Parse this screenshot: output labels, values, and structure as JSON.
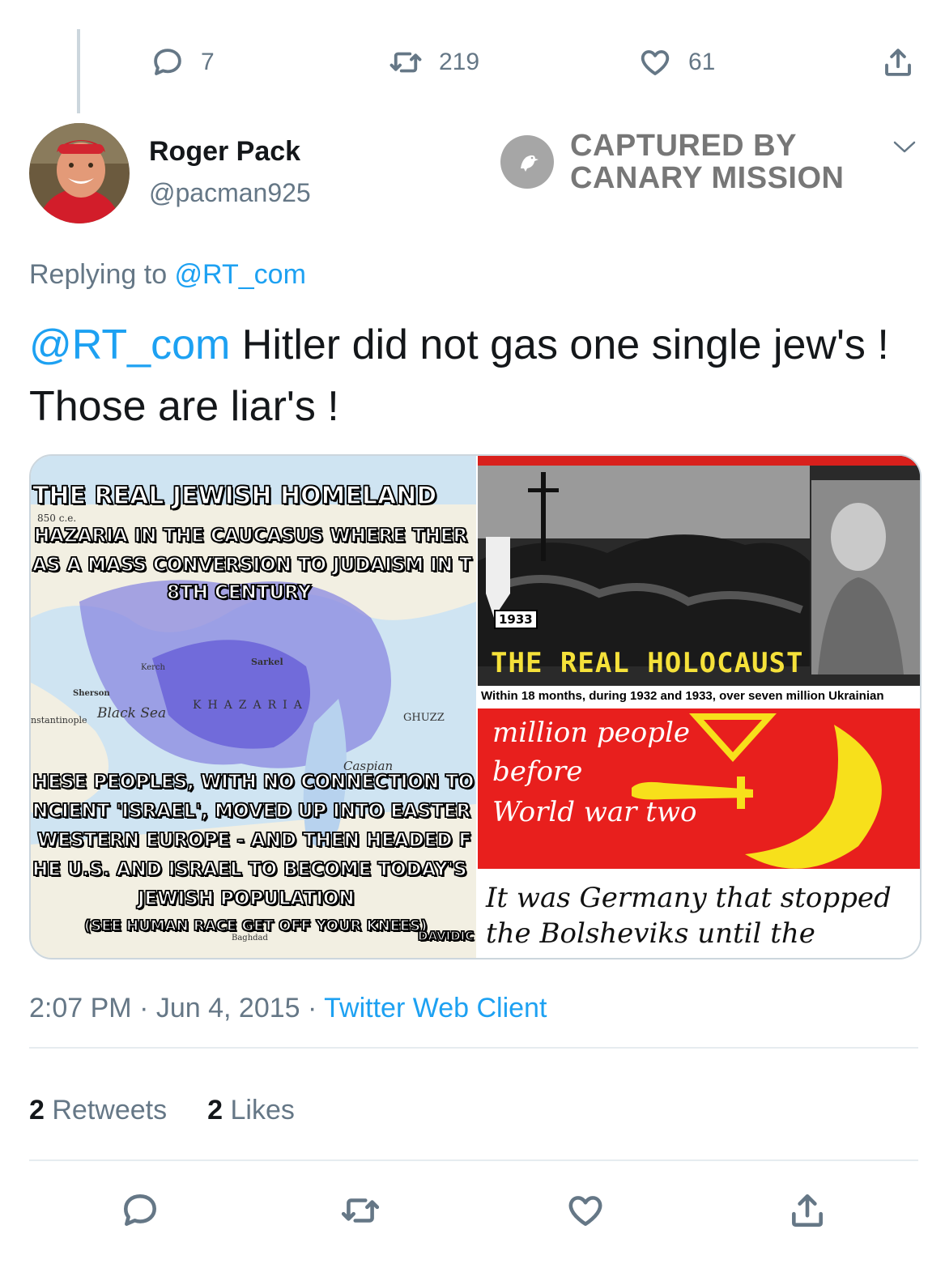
{
  "top_actions": {
    "replies": "7",
    "retweets": "219",
    "likes": "61"
  },
  "author": {
    "name": "Roger Pack",
    "handle": "@pacman925"
  },
  "watermark": {
    "line1": "CAPTURED BY",
    "line2": "CANARY MISSION"
  },
  "reply": {
    "prefix": "Replying to ",
    "mention": "@RT_com"
  },
  "tweet": {
    "mention": "@RT_com",
    "text": " Hitler did not gas one single jew's !  Those are liar's !"
  },
  "media": {
    "map": {
      "title": "THE REAL JEWISH HOMELAND",
      "line1": "HAZARIA IN THE CAUCASUS WHERE THER",
      "line2": "AS A MASS CONVERSION TO JUDAISM IN T",
      "line3": "8TH CENTURY",
      "line4": "HESE PEOPLES, WITH NO CONNECTION TO",
      "line5": "NCIENT 'ISRAEL', MOVED UP INTO EASTER",
      "line6": "WESTERN EUROPE - AND THEN HEADED F",
      "line7": "HE U.S. AND ISRAEL TO BECOME TODAY'S",
      "line8": "JEWISH POPULATION",
      "line9": "(SEE HUMAN RACE GET OFF YOUR KNEES)",
      "credit": "DAVIDIC",
      "labels": {
        "black_sea": "Black Sea",
        "khazaria": "KHAZARIA",
        "ghuzz": "GHUZZ",
        "sarkel": "Sarkel",
        "kerch": "Kerch",
        "sherson": "Sherson",
        "caspian": "Caspian",
        "baghdad": "Baghdad",
        "constantinople": "nstantinople",
        "c850": "850 c.e."
      }
    },
    "photo": {
      "year": "1933",
      "headline": "THE REAL HOLOCAUST",
      "caption": "Within 18 months, during 1932 and 1933, over seven million Ukrainian"
    },
    "red": {
      "line1": "million people",
      "line2": "before",
      "line3": "World war two",
      "line4": "It was Germany that stopped",
      "line5": "the Bolsheviks until the"
    }
  },
  "meta": {
    "time": "2:07 PM",
    "sep1": " · ",
    "date": "Jun 4, 2015",
    "sep2": " · ",
    "client": "Twitter Web Client"
  },
  "stats": {
    "retweets_count": "2",
    "retweets_label": " Retweets",
    "likes_count": "2",
    "likes_label": " Likes"
  },
  "colors": {
    "link": "#1da1f2",
    "secondary": "#657786",
    "border": "#e6ecf0"
  },
  "icons": [
    "reply-icon",
    "retweet-icon",
    "like-icon",
    "share-icon",
    "chevron-down-icon",
    "canary-logo-icon"
  ]
}
